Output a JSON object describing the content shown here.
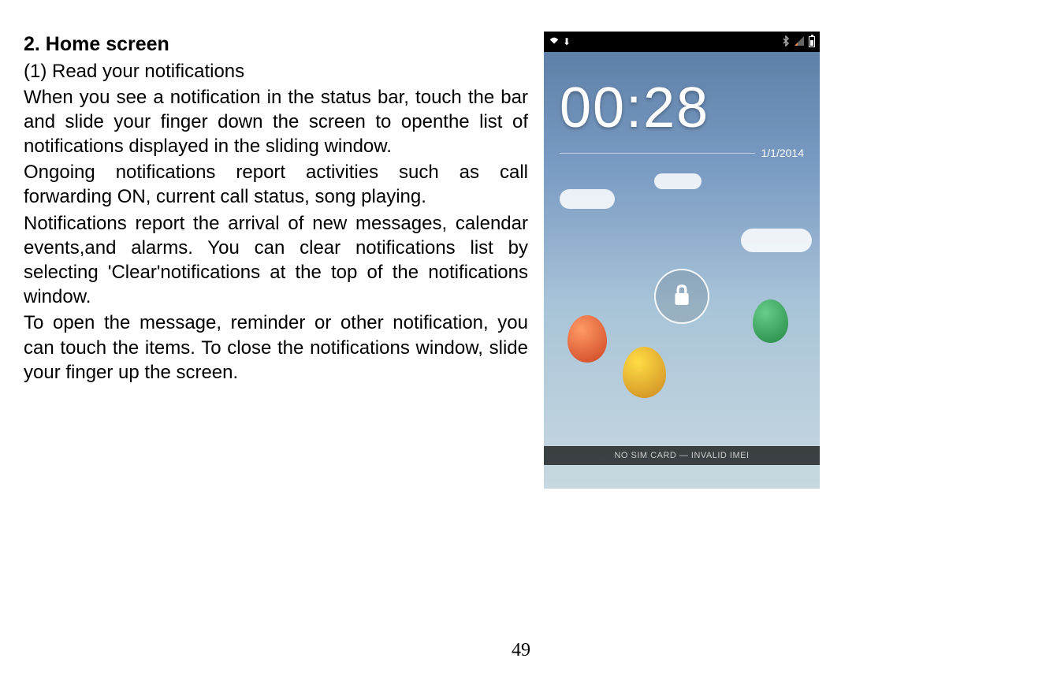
{
  "document": {
    "heading": "2. Home screen",
    "subsection": "(1) Read your notifications",
    "paragraphs": [
      "When you see a notification in the status bar, touch the bar and slide your finger down the screen to openthe list of notifications displayed in the sliding window.",
      "Ongoing notifications report activities such as call forwarding ON, current call status, song playing.",
      "Notifications report the arrival of new messages, calendar events,and alarms. You can clear notifications list by selecting 'Clear'notifications at the top of the notifications window.",
      "To open the message, reminder or other notification, you can touch the items. To close the notifications window, slide your finger up the screen."
    ],
    "page_number": "49"
  },
  "phone": {
    "time": "00:28",
    "date": "1/1/2014",
    "bottom_text": "NO SIM CARD — INVALID IMEI",
    "status_icons": {
      "wifi": "wifi-icon",
      "download": "download-icon",
      "bluetooth": "bluetooth-icon",
      "signal": "signal-icon",
      "battery": "battery-icon"
    }
  }
}
